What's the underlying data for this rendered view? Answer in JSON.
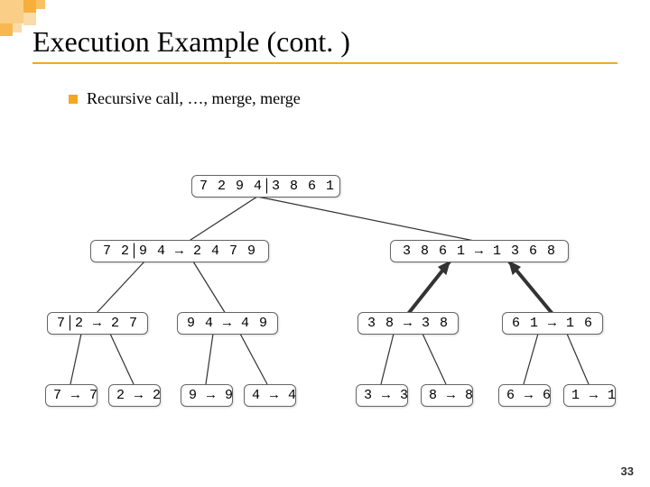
{
  "slide": {
    "title": "Execution Example (cont. )",
    "bullet": "Recursive call, …, merge, merge",
    "page_number": "33"
  },
  "tree": {
    "level0": {
      "n0": "7 2 9 4│3 8 6 1"
    },
    "level1": {
      "n0": "7 2│9 4 → 2 4 7 9",
      "n1": "3 8 6 1 → 1 3 6 8"
    },
    "level2": {
      "n0": "7│2 → 2 7",
      "n1": "9 4 → 4 9",
      "n2": "3 8 → 3 8",
      "n3": "6 1 → 1 6"
    },
    "level3": {
      "n0": "7 → 7",
      "n1": "2 → 2",
      "n2": "9 → 9",
      "n3": "4 → 4",
      "n4": "3 → 3",
      "n5": "8 → 8",
      "n6": "6 → 6",
      "n7": "1 → 1"
    }
  }
}
